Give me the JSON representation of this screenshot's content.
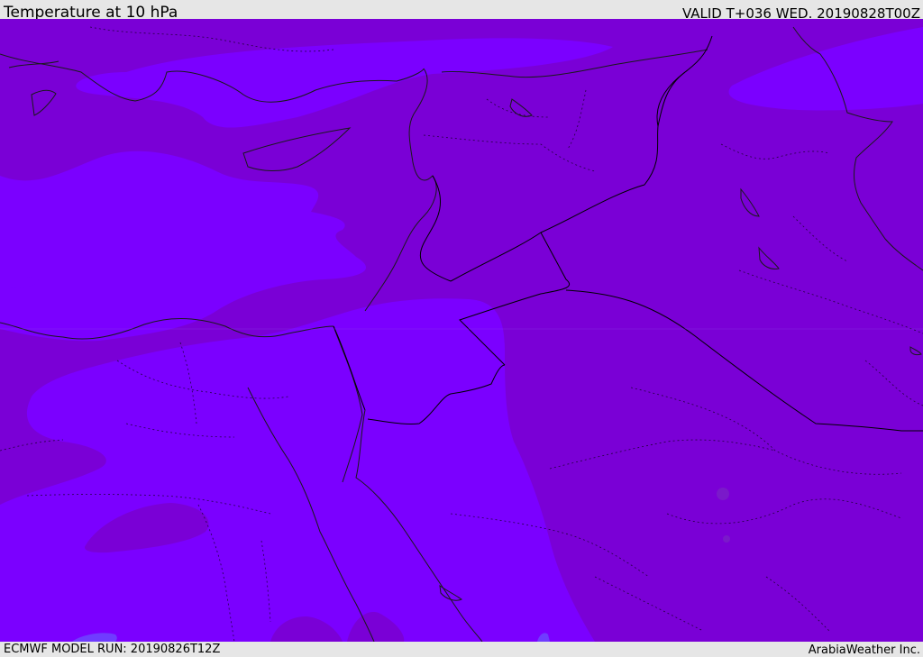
{
  "header": {
    "title": "Temperature at 10 hPa",
    "valid": "VALID T+036 WED. 20190828T00Z"
  },
  "footer": {
    "model_run": "ECMWF MODEL RUN: 20190826T12Z",
    "brand": "ArabiaWeather Inc."
  },
  "colors": {
    "warm_band": "#7a00d6",
    "cool_band": "#7b00ff",
    "coolest_patch": "#6f3cff",
    "coastline": "#1a1a1a",
    "border": "#000000"
  }
}
